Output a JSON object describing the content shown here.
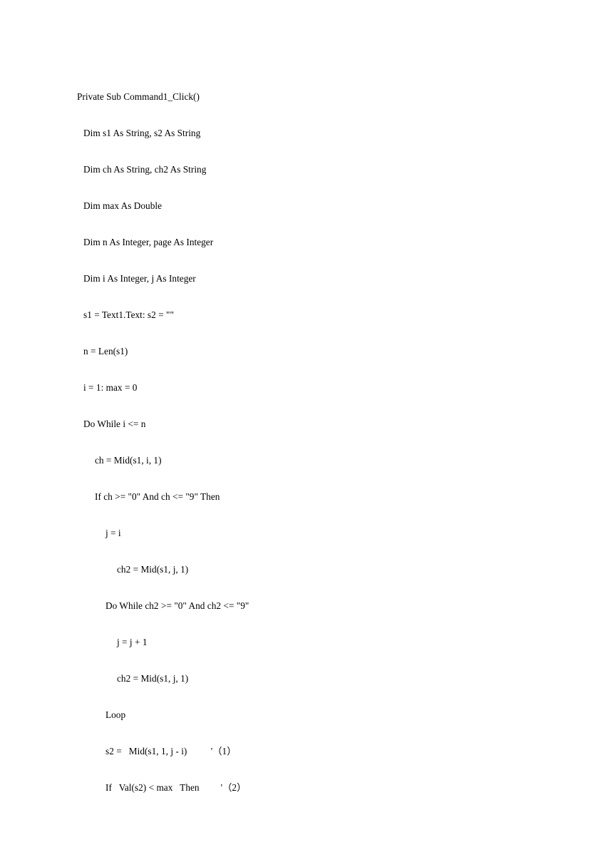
{
  "document": {
    "page_background": "#ffffff",
    "text_color": "#000000",
    "language": "Visual Basic",
    "code_lines": [
      {
        "id": "line-1",
        "indent": 0,
        "text": "Private Sub Command1_Click()"
      },
      {
        "id": "line-2",
        "indent": 1,
        "text": "Dim s1 As String, s2 As String"
      },
      {
        "id": "line-3",
        "indent": 1,
        "text": "Dim ch As String, ch2 As String"
      },
      {
        "id": "line-4",
        "indent": 1,
        "text": "Dim max As Double"
      },
      {
        "id": "line-5",
        "indent": 1,
        "text": "Dim n As Integer, page As Integer"
      },
      {
        "id": "line-6",
        "indent": 1,
        "text": "Dim i As Integer, j As Integer"
      },
      {
        "id": "line-7",
        "indent": 1,
        "text": "s1 = Text1.Text: s2 = \"\""
      },
      {
        "id": "line-8",
        "indent": 1,
        "text": "n = Len(s1)"
      },
      {
        "id": "line-9",
        "indent": 1,
        "text": "i = 1: max = 0"
      },
      {
        "id": "line-10",
        "indent": 1,
        "text": "Do While i <= n"
      },
      {
        "id": "line-11",
        "indent": 2,
        "text": "ch = Mid(s1, i, 1)"
      },
      {
        "id": "line-12",
        "indent": 2,
        "text": "If ch >= \"0\" And ch <= \"9\" Then"
      },
      {
        "id": "line-13",
        "indent": 3,
        "text": "j = i"
      },
      {
        "id": "line-14",
        "indent": 4,
        "text": "ch2 = Mid(s1, j, 1)"
      },
      {
        "id": "line-15",
        "indent": 3,
        "text": "Do While ch2 >= \"0\" And ch2 <= \"9\""
      },
      {
        "id": "line-16",
        "indent": 4,
        "text": "j = j + 1"
      },
      {
        "id": "line-17",
        "indent": 4,
        "text": "ch2 = Mid(s1, j, 1)"
      },
      {
        "id": "line-18",
        "indent": 3,
        "text": "Loop"
      },
      {
        "id": "line-19",
        "indent": 3,
        "text": "s2 =   Mid(s1, 1, j - i)          '（1）"
      },
      {
        "id": "line-20",
        "indent": 3,
        "text": "If   Val(s2) < max   Then         '（2）"
      }
    ],
    "annotations": [
      {
        "marker": "'（1）",
        "on_line": "line-19"
      },
      {
        "marker": "'（2）",
        "on_line": "line-20"
      }
    ]
  }
}
